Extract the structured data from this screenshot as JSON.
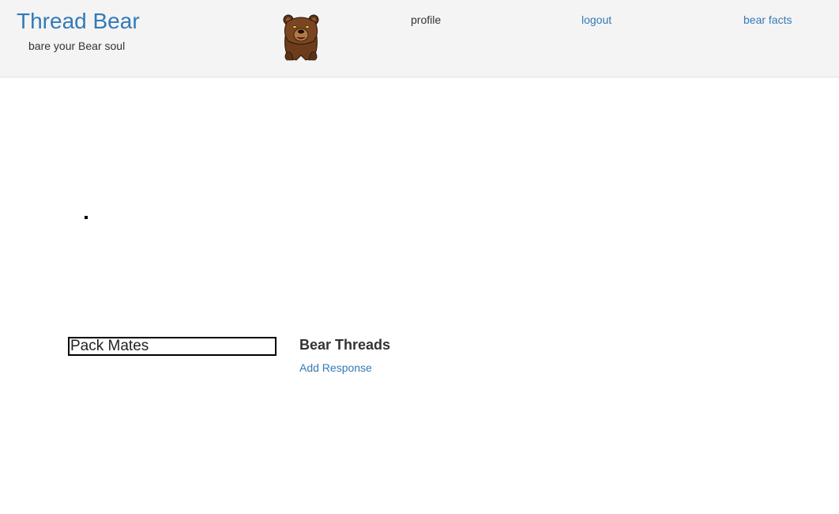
{
  "header": {
    "brand": "Thread Bear",
    "tagline": "bare your Bear soul",
    "logo_icon": "bear-logo-icon",
    "nav": {
      "profile": "profile",
      "logout": "logout",
      "bear_facts": "bear facts"
    }
  },
  "main": {
    "pack_mates_title": "Pack Mates",
    "threads_title": "Bear Threads",
    "add_response_label": "Add Response"
  },
  "colors": {
    "link": "#337ab7",
    "navbar_bg": "#f4f4f4",
    "text": "#333333"
  }
}
